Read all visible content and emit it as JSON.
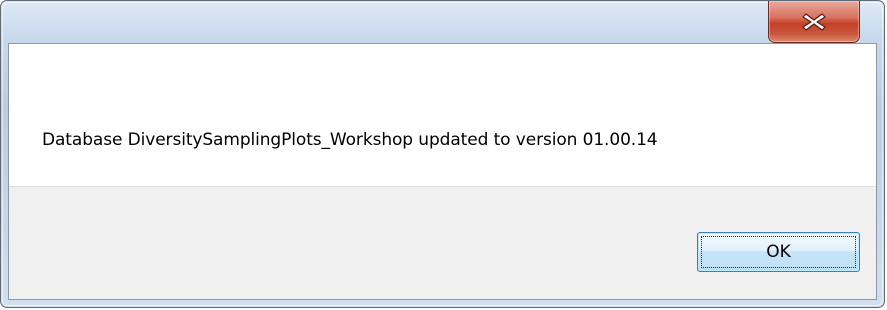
{
  "window": {
    "title": "",
    "close_icon": "close-icon",
    "close_button_color": "#c4412a"
  },
  "message": {
    "text": "Database DiversitySamplingPlots_Workshop updated to version  01.00.14"
  },
  "buttons": {
    "ok_label": "OK"
  }
}
